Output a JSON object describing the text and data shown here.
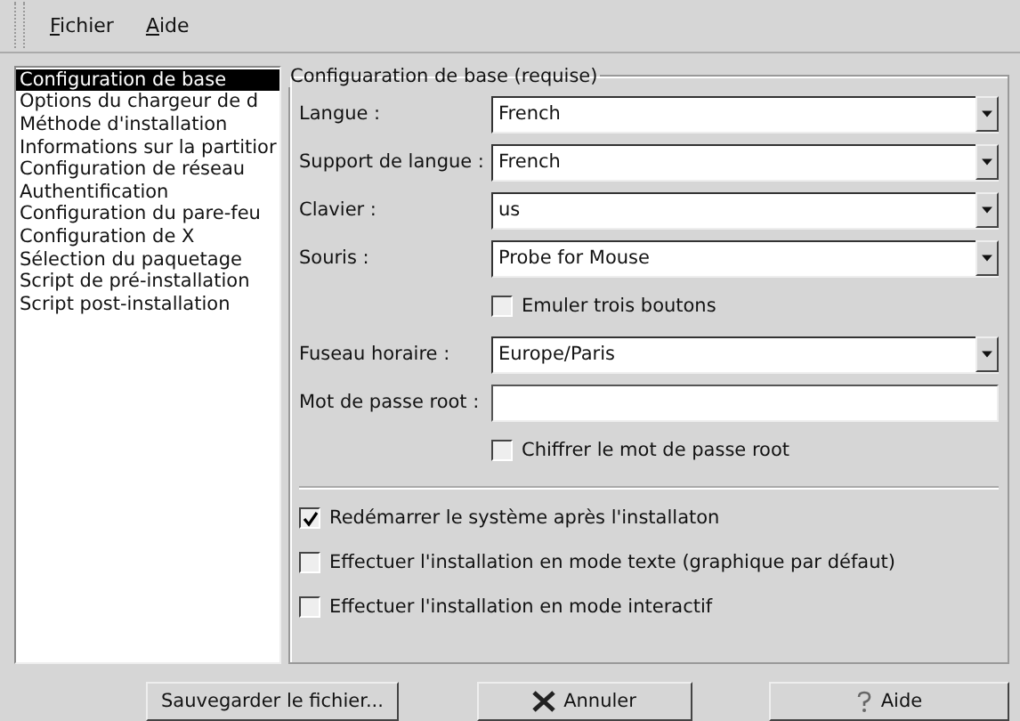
{
  "menu": [
    {
      "label": "Fichier"
    },
    {
      "label": "Aide"
    }
  ],
  "sidebar": {
    "items": [
      {
        "label": "Configuration de base",
        "selected": true
      },
      {
        "label": "Options du chargeur de d",
        "selected": false
      },
      {
        "label": "Méthode d'installation",
        "selected": false
      },
      {
        "label": "Informations sur la partitior",
        "selected": false
      },
      {
        "label": "Configuration de réseau",
        "selected": false
      },
      {
        "label": "Authentification",
        "selected": false
      },
      {
        "label": "Configuration du pare-feu",
        "selected": false
      },
      {
        "label": "Configuration de X",
        "selected": false
      },
      {
        "label": "Sélection du paquetage",
        "selected": false
      },
      {
        "label": "Script de pré-installation",
        "selected": false
      },
      {
        "label": "Script post-installation",
        "selected": false
      }
    ]
  },
  "panel": {
    "title": "Configuaration de base (requise)",
    "fields": [
      {
        "kind": "select",
        "label": "Langue :",
        "value": "French"
      },
      {
        "kind": "select",
        "label": "Support de langue :",
        "value": "French"
      },
      {
        "kind": "select",
        "label": "Clavier :",
        "value": "us"
      },
      {
        "kind": "select",
        "label": "Souris :",
        "value": "Probe for Mouse"
      },
      {
        "kind": "checkbox",
        "label": "Emuler trois boutons",
        "checked": false
      },
      {
        "kind": "select",
        "label": "Fuseau horaire :",
        "value": "Europe/Paris"
      },
      {
        "kind": "text",
        "label": "Mot de passe root :"
      },
      {
        "kind": "checkbox",
        "label": "Chiffrer le mot de passe root",
        "checked": false
      }
    ],
    "options": [
      {
        "label": "Redémarrer le système après l'installaton",
        "checked": true
      },
      {
        "label": "Effectuer l'installation en mode texte (graphique par défaut)",
        "checked": false
      },
      {
        "label": "Effectuer l'installation en mode interactif",
        "checked": false
      }
    ]
  },
  "buttons": [
    {
      "kind": "save",
      "label": "Sauvegarder le fichier..."
    },
    {
      "kind": "cancel",
      "label": "Annuler"
    },
    {
      "kind": "help",
      "label": "Aide"
    }
  ]
}
